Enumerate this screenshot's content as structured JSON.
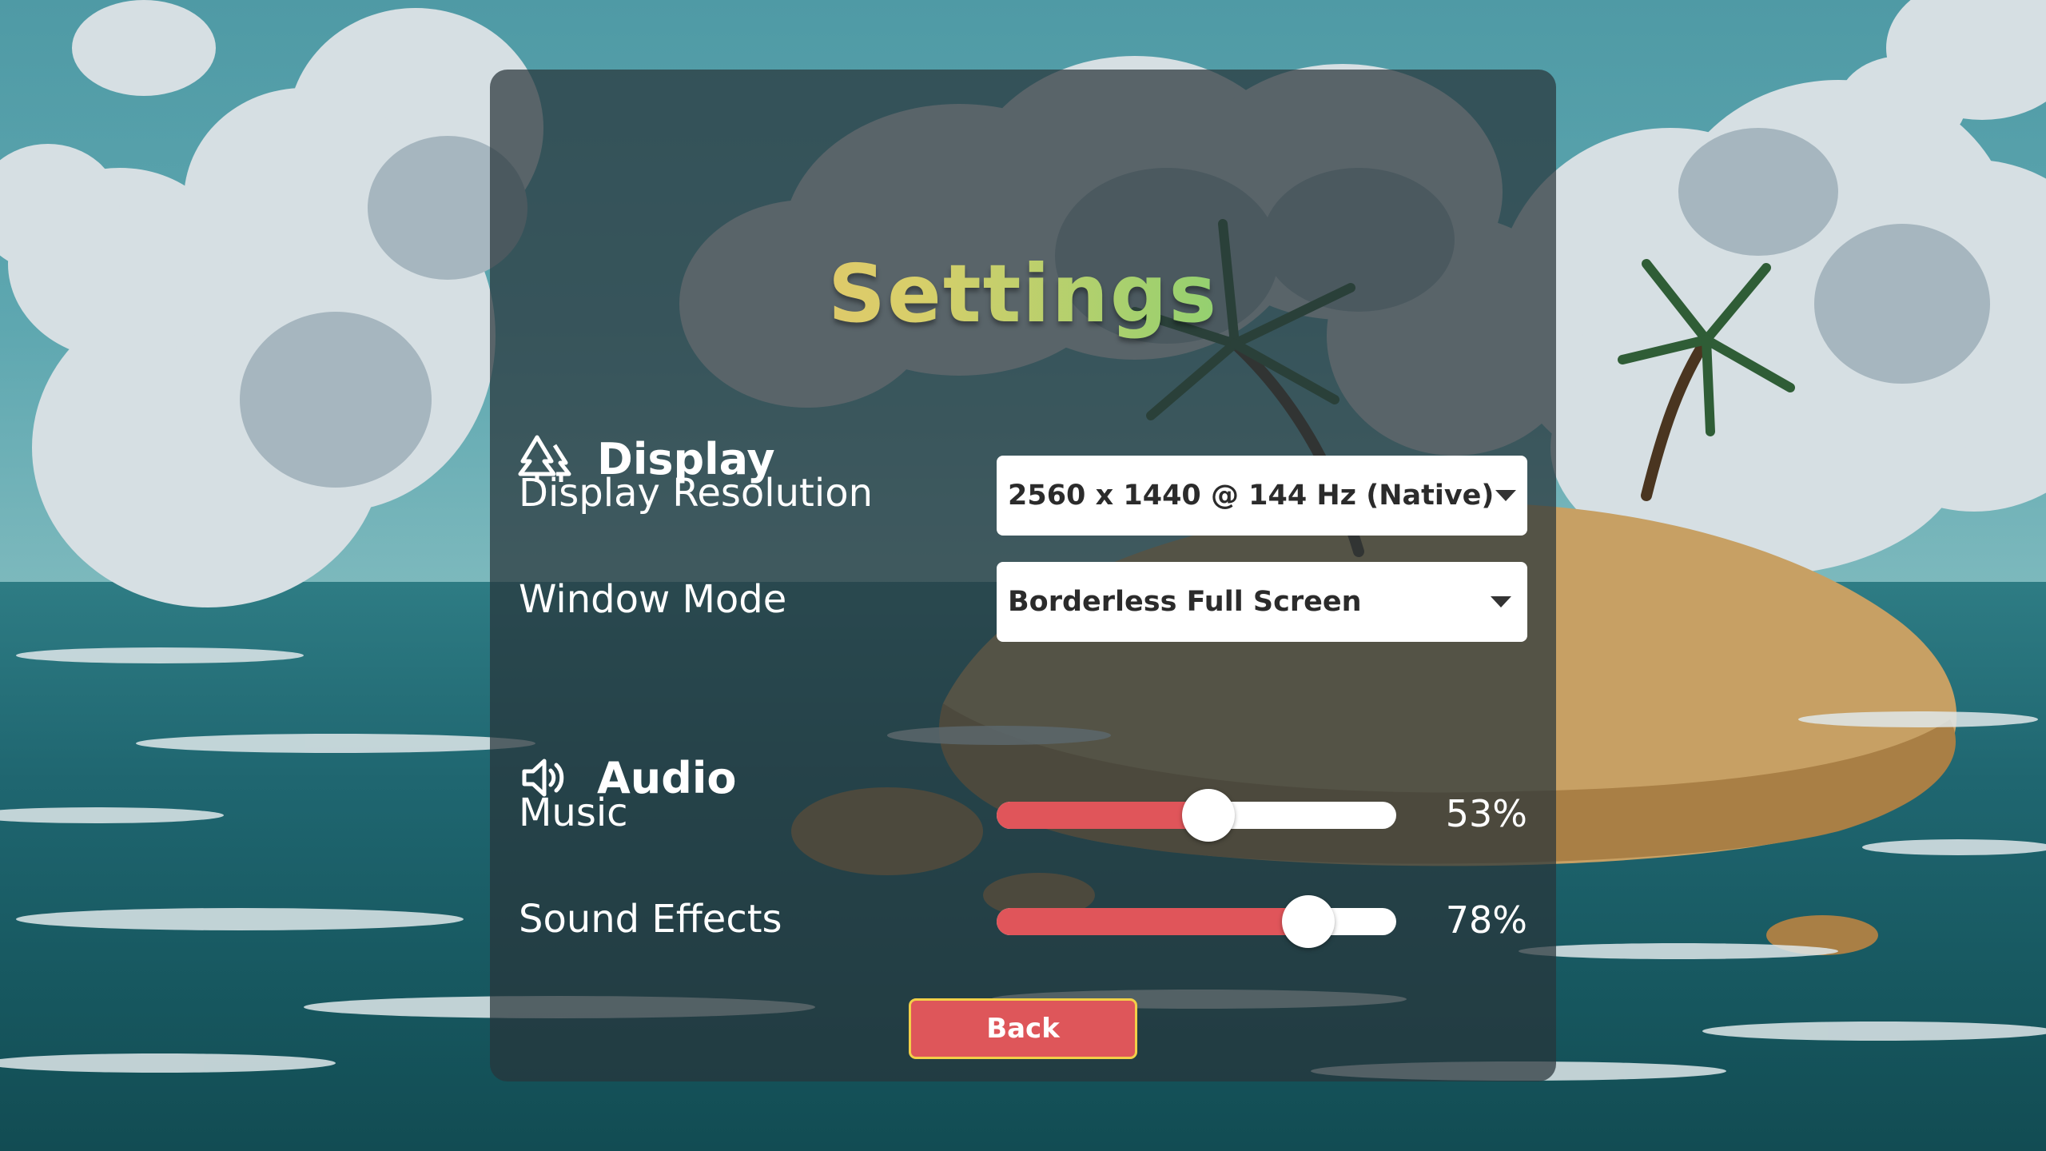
{
  "title": "Settings",
  "sections": {
    "display": {
      "label": "Display",
      "icon": "trees-icon",
      "resolution": {
        "label": "Display Resolution",
        "value": "2560 x 1440 @ 144 Hz (Native)"
      },
      "window_mode": {
        "label": "Window Mode",
        "value": "Borderless Full Screen"
      }
    },
    "audio": {
      "label": "Audio",
      "icon": "speaker-icon",
      "music": {
        "label": "Music",
        "percent": 53,
        "display": "53%"
      },
      "sound_effects": {
        "label": "Sound Effects",
        "percent": 78,
        "display": "78%"
      }
    }
  },
  "back_button": "Back",
  "colors": {
    "accent_fill": "#e0555a",
    "button_border": "#f2cf48",
    "panel": "#28343a"
  }
}
